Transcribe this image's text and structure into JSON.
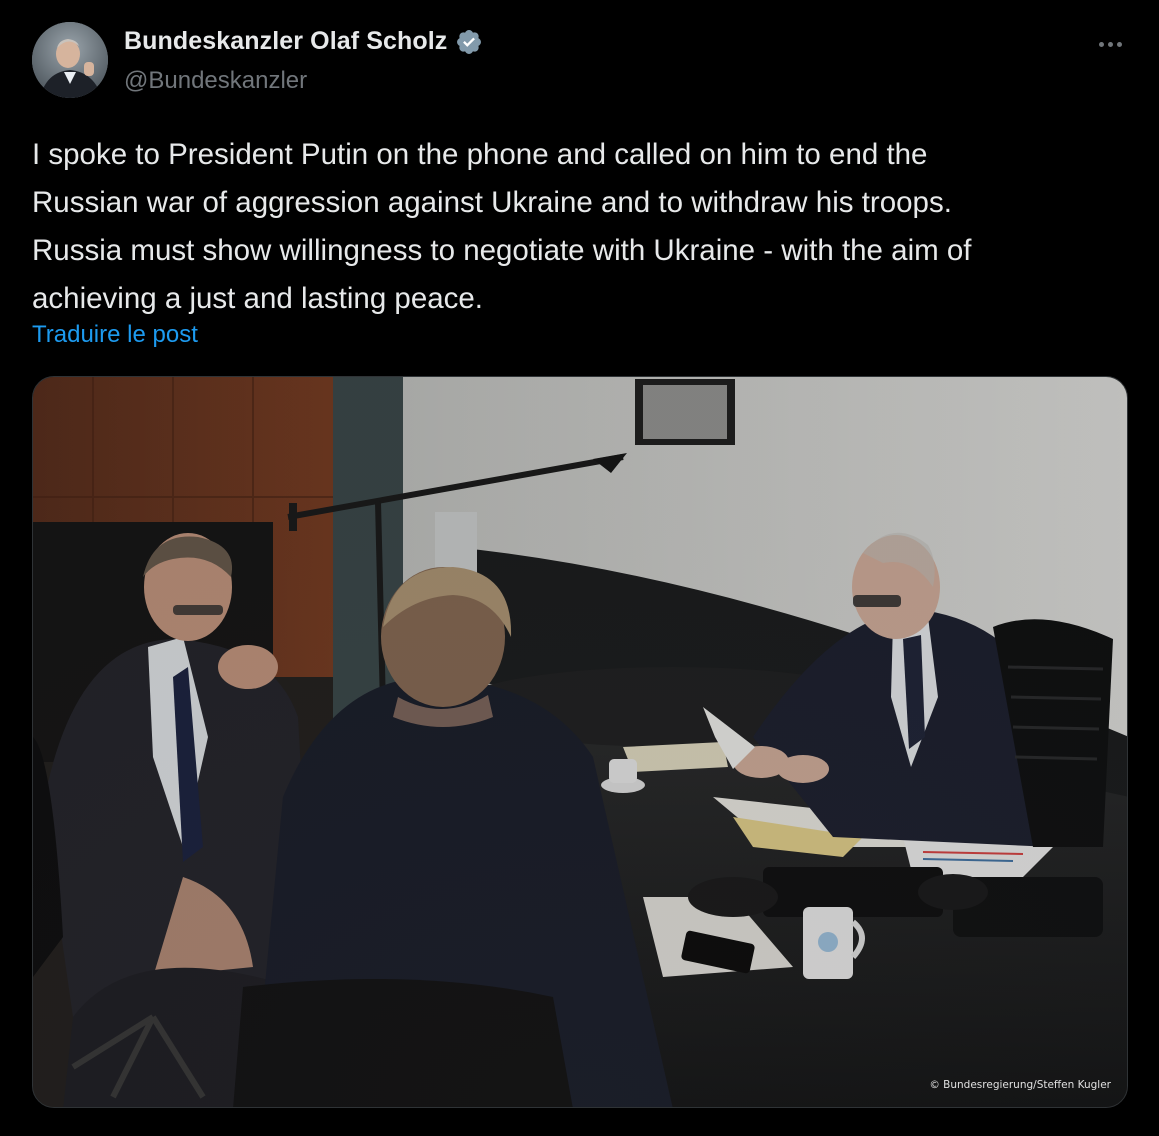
{
  "author": {
    "name": "Bundeskanzler Olaf Scholz",
    "handle": "@Bundeskanzler",
    "verified": true,
    "avatar_icon": "profile-avatar"
  },
  "post": {
    "text": "I spoke to President Putin on the phone and called on him to end the\nRussian war of aggression against Ukraine and to withdraw his troops.\nRussia must show willingness to negotiate with Ukraine - with the aim of\nachieving a just and lasting peace.",
    "translate_label": "Traduire le post",
    "more_icon": "more-options-icon"
  },
  "media": {
    "photo_credit": "© Bundesregierung/Steffen Kugler"
  },
  "colors": {
    "background": "#000000",
    "text_primary": "#e7e9ea",
    "text_secondary": "#71767b",
    "link": "#1d9bf0",
    "verified_badge": "#829aab"
  }
}
